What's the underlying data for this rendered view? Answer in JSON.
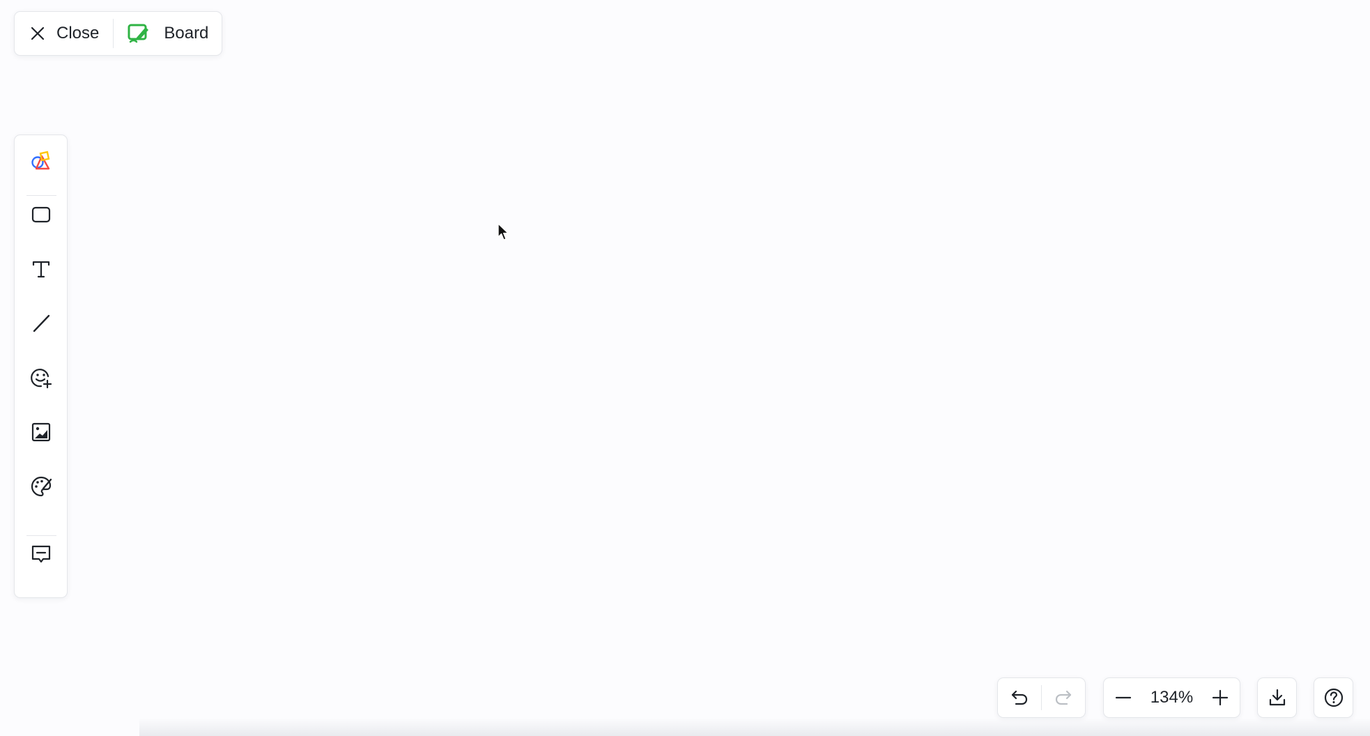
{
  "titlebar": {
    "close_label": "Close",
    "board_label": "Board",
    "board_icon_color": "#2fb344"
  },
  "toolbar": {
    "items": [
      {
        "name": "shapes-icon"
      },
      {
        "name": "rectangle-icon"
      },
      {
        "name": "text-icon"
      },
      {
        "name": "line-icon"
      },
      {
        "name": "sticker-icon"
      },
      {
        "name": "image-icon"
      },
      {
        "name": "palette-icon"
      },
      {
        "name": "comment-icon"
      }
    ]
  },
  "controls": {
    "zoom_value": "134%"
  },
  "colors": {
    "shape_blue": "#3370ff",
    "shape_red": "#f54a45",
    "shape_yellow": "#ffc60a",
    "icon_dark": "#1f2329",
    "icon_disabled": "#bbbfc4"
  }
}
